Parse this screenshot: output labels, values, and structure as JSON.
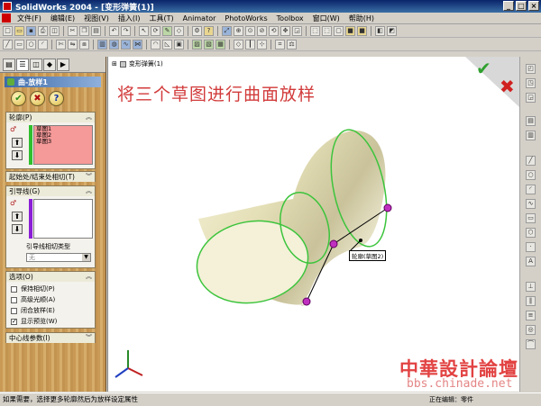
{
  "window": {
    "title": "SolidWorks 2004 - [变形弹簧(1)]",
    "controls": [
      "_",
      "□",
      "×"
    ]
  },
  "menu": [
    "文件(F)",
    "编辑(E)",
    "视图(V)",
    "插入(I)",
    "工具(T)",
    "Animator",
    "PhotoWorks",
    "Toolbox",
    "窗口(W)",
    "帮助(H)"
  ],
  "feature_tabs": [
    "feature-manager",
    "property-manager",
    "configuration-manager",
    "dimxpert",
    "display-manager"
  ],
  "property_manager": {
    "title": "曲-放样1",
    "buttons": {
      "ok": "✔",
      "cancel": "✖",
      "help": "?"
    },
    "profiles": {
      "header": "轮廓(P)",
      "items": [
        "草图1",
        "草图2",
        "草图3"
      ]
    },
    "start_end": {
      "header": "起始处/结束处相切(T)"
    },
    "guides": {
      "header": "引导线(G)",
      "tangency_label": "引导线相切类型",
      "tangency_value": "无"
    },
    "options": {
      "header": "选项(O)",
      "items": [
        {
          "label": "保持相切(P)",
          "checked": false
        },
        {
          "label": "高级光顺(A)",
          "checked": false
        },
        {
          "label": "闭合放样(E)",
          "checked": false
        },
        {
          "label": "显示预览(W)",
          "checked": true
        }
      ]
    },
    "centerline": {
      "header": "中心线参数(I)"
    }
  },
  "viewport": {
    "tree_item": "变形弹簧(1)",
    "annotation": "将三个草图进行曲面放样",
    "callout": "轮廓(草图2)",
    "confirm_ok": "✔",
    "confirm_cancel": "✖"
  },
  "status": {
    "left": "如果需要，选择更多轮廓然后为放样设定属性",
    "right": "正在编辑：零件"
  },
  "watermark": {
    "text": "中華設計論壇",
    "url": "bbs.chinade.net"
  },
  "colors": {
    "annotation": "#d23a3a",
    "profile_list_bg": "#f59999",
    "profile_bar": "#2fbf2f",
    "guide_bar": "#8a1fd6",
    "surface_edge": "#3cc43c",
    "surface_fill": "#ece8c4",
    "guide_point": "#c030c0"
  }
}
